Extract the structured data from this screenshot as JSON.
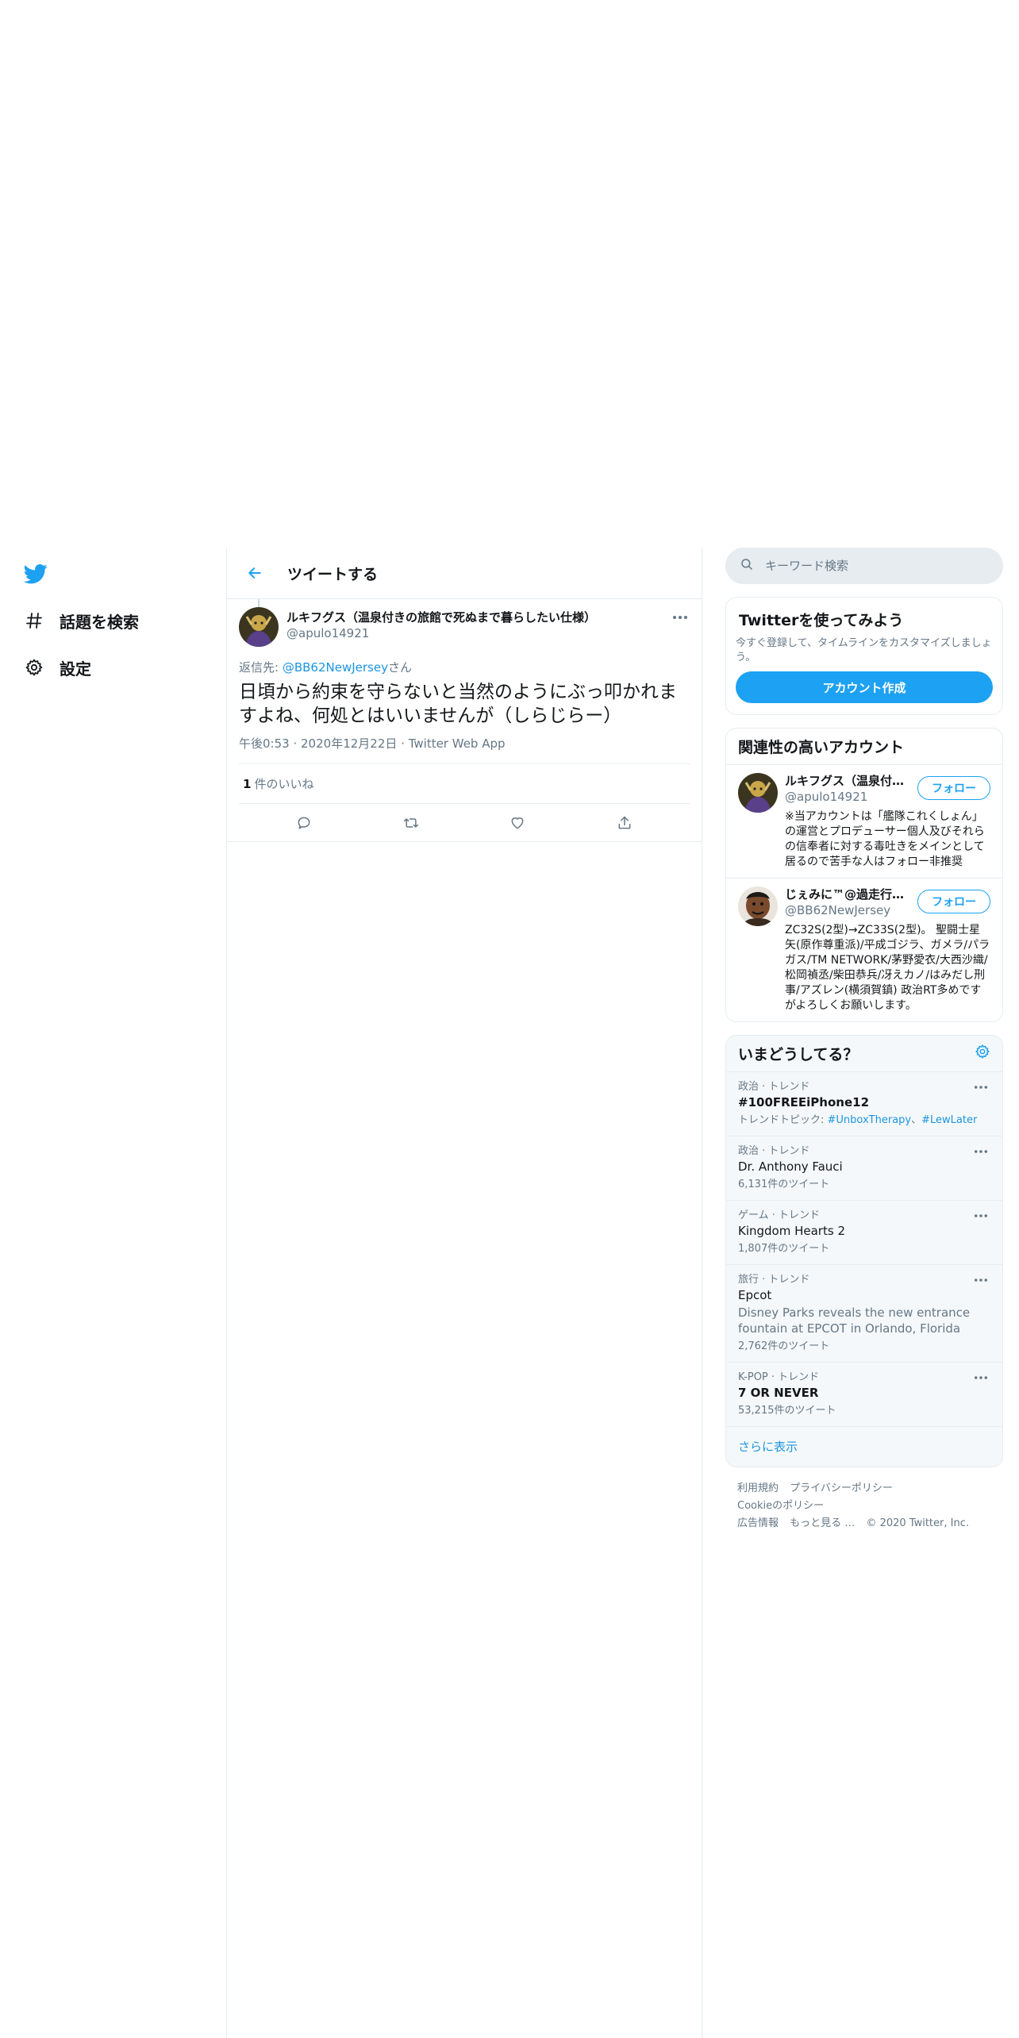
{
  "nav": {
    "logo_icon": "twitter-bird-icon",
    "items": [
      {
        "icon": "hashtag-icon",
        "label": "話題を検索"
      },
      {
        "icon": "gear-icon",
        "label": "設定"
      }
    ]
  },
  "header": {
    "title": "ツイートする",
    "back_icon": "back-arrow-icon"
  },
  "tweet": {
    "author_name": "ルキフグス（温泉付きの旅館で死ぬまで暮らしたい仕様）",
    "author_handle": "@apulo14921",
    "reply_prefix": "返信先: ",
    "reply_handle": "@BB62NewJersey",
    "reply_suffix": "さん",
    "text": "日頃から約束を守らないと当然のようにぶっ叩かれますよね、何処とはいいませんが（しらじらー）",
    "time": "午後0:53",
    "date": "2020年12月22日",
    "source": "Twitter Web App",
    "like_count": "1",
    "like_label": "件のいいね"
  },
  "search": {
    "placeholder": "キーワード検索"
  },
  "signup": {
    "title": "Twitterを使ってみよう",
    "text": "今すぐ登録して、タイムラインをカスタマイズしましょう。",
    "button": "アカウント作成"
  },
  "related": {
    "title": "関連性の高いアカウント",
    "follow_label": "フォロー",
    "accounts": [
      {
        "name": "ルキフグス（温泉付きの旅館で死ぬまで暮らしたい仕様）",
        "handle": "@apulo14921",
        "bio": "※当アカウントは「艦隊これくしょん」の運営とプロデューサー個人及びそれらの信奉者に対する毒吐きをメインとして居るので苦手な人はフォロー非推奨"
      },
      {
        "name": "じぇみに™@過走行車両愛好会",
        "handle": "@BB62NewJersey",
        "bio": "ZC32S(2型)→ZC33S(2型)。 聖闘士星矢(原作尊重派)/平成ゴジラ、ガメラ/パラガス/TM NETWORK/茅野愛衣/大西沙織/松岡禎丞/柴田恭兵/冴えカノ/はみだし刑事/アズレン(横須賀鎮) 政治RT多めですがよろしくお願いします。"
      }
    ]
  },
  "trends": {
    "title": "いまどうしてる？",
    "settings_icon": "gear-icon",
    "items": [
      {
        "category": "政治 · トレンド",
        "name": "#100FREEiPhone12",
        "sub_prefix": "トレンドトピック: ",
        "tag1": "#UnboxTherapy",
        "sep": "、",
        "tag2": "#LewLater"
      },
      {
        "category": "政治 · トレンド",
        "name": "Dr. Anthony Fauci",
        "count": "6,131件のツイート"
      },
      {
        "category": "ゲーム · トレンド",
        "name": "Kingdom Hearts 2",
        "count": "1,807件のツイート"
      },
      {
        "category": "旅行 · トレンド",
        "name": "Epcot",
        "desc": "Disney Parks reveals the new entrance fountain at EPCOT in Orlando, Florida",
        "count": "2,762件のツイート"
      },
      {
        "category": "K-POP · トレンド",
        "name": "7 OR NEVER",
        "count": "53,215件のツイート"
      }
    ],
    "show_more": "さらに表示"
  },
  "footer": {
    "links": [
      "利用規約",
      "プライバシーポリシー",
      "Cookieのポリシー",
      "広告情報",
      "もっと見る …"
    ],
    "copyright": "© 2020 Twitter, Inc."
  },
  "colors": {
    "accent": "#1da1f2",
    "link": "#1b95e0",
    "muted": "#657786",
    "border": "#e6ecf0"
  }
}
